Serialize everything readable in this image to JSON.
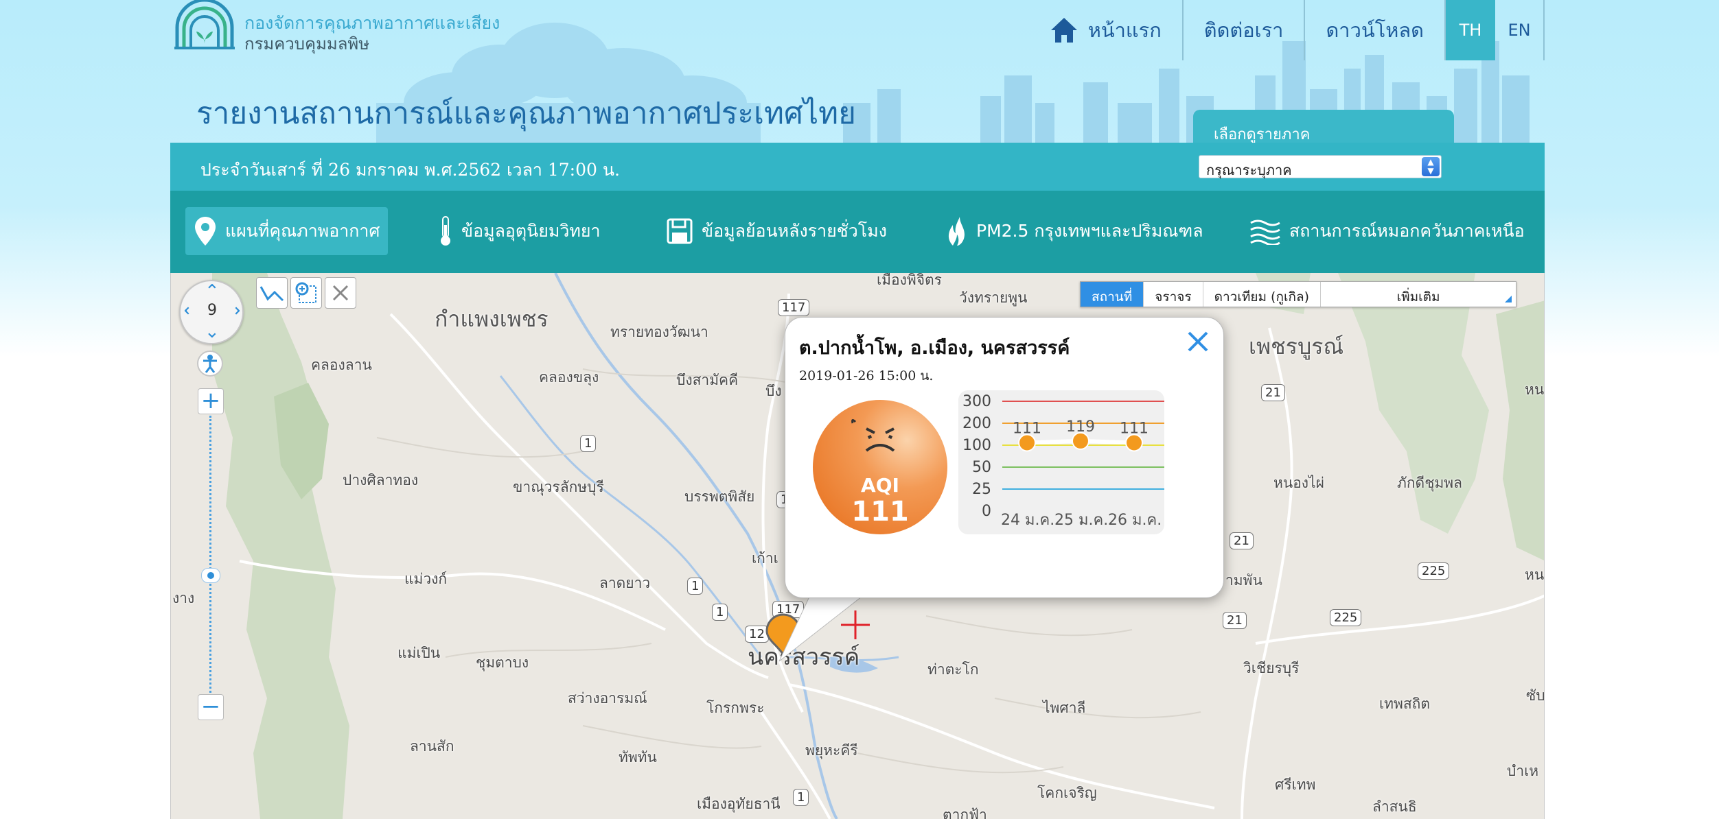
{
  "header": {
    "dept_line1": "กองจัดการคุณภาพอากาศและเสียง",
    "dept_line2": "กรมควบคุมมลพิษ",
    "site_title": "รายงานสถานการณ์และคุณภาพอากาศประเทศไทย",
    "nav": [
      {
        "label": "หน้าแรก",
        "icon": "home-icon"
      },
      {
        "label": "ติดต่อเรา"
      },
      {
        "label": "ดาวน์โหลด"
      }
    ],
    "languages": [
      "TH",
      "EN"
    ],
    "active_language": "TH"
  },
  "region": {
    "tab_label": "เลือกดูรายภาค",
    "select_value": "กรุณาระบุภาค"
  },
  "date_text": "ประจำวันเสาร์ ที่ 26 มกราคม พ.ศ.2562 เวลา 17:00 น.",
  "main_nav": [
    {
      "label": "แผนที่คุณภาพอากาศ",
      "icon": "map-pin-icon",
      "active": true
    },
    {
      "label": "ข้อมูลอุตุนิยมวิทยา",
      "icon": "thermometer-icon"
    },
    {
      "label": "ข้อมูลย้อนหลังรายชั่วโมง",
      "icon": "save-icon"
    },
    {
      "label": "PM2.5 กรุงเทพฯและปริมณฑล",
      "icon": "flame-icon"
    },
    {
      "label": "สถานการณ์หมอกควันภาคเหนือ",
      "icon": "haze-icon"
    }
  ],
  "map": {
    "zoom_level": "9",
    "map_types": [
      "สถานที่",
      "จราจร",
      "ดาวเทียม (กูเกิล)",
      "เพิ่มเติม"
    ],
    "active_map_type": "สถานที่",
    "places": [
      "กำแพงเพชร",
      "เพชรบูรณ์",
      "นครสวรรค์",
      "คลองลาน",
      "คลองขลุง",
      "บึงสามัคคี",
      "ทรายทองวัฒนา",
      "เมืองพิจิตร",
      "วังทรายพูน",
      "ปางศิลาทอง",
      "ขาณุวรลักษบุรี",
      "บรรพตพิสัย",
      "แม่วงก์",
      "ลาดยาว",
      "แม่เปิน",
      "ชุมตาบง",
      "สว่างอารมณ์",
      "โกรกพระ",
      "ท่าตะโก",
      "ไพศาลี",
      "ทัพทัน",
      "พยุหะคีรี",
      "ลานสัก",
      "เมืองอุทัยธานี",
      "โคกเจริญ",
      "ศรีเทพ",
      "ลำสนธิ",
      "วิเชียรบุรี",
      "เทพสถิต",
      "หนองไผ่",
      "ภักดีชุมพล",
      "หนองบัว",
      "บึง",
      "เก้าเ",
      "งาง",
      "ามพัน",
      "หนองบั",
      "ซับใ",
      "บำเห",
      "ตากฟ้า"
    ],
    "road_shields": [
      "117",
      "117",
      "1",
      "1",
      "1",
      "1",
      "1",
      "12",
      "21",
      "21",
      "21",
      "225",
      "225"
    ]
  },
  "popup": {
    "title": "ต.ปากน้ำโพ, อ.เมือง, นครสวรรค์",
    "timestamp": "2019-01-26 15:00 น.",
    "aqi_label": "AQI",
    "aqi_value": "111",
    "aqi_color": "#f0883a"
  },
  "chart_data": {
    "type": "line",
    "categories": [
      "24 ม.ค.",
      "25 ม.ค.",
      "26 ม.ค."
    ],
    "values": [
      111,
      119,
      111
    ],
    "y_ticks": [
      0,
      25,
      50,
      100,
      200,
      300
    ],
    "threshold_lines": [
      {
        "value": 300,
        "color": "#e05050"
      },
      {
        "value": 200,
        "color": "#f0a030"
      },
      {
        "value": 100,
        "color": "#e8e040"
      },
      {
        "value": 50,
        "color": "#7cc060"
      },
      {
        "value": 25,
        "color": "#40b0e0"
      }
    ],
    "point_color": "#f39a1e",
    "data_labels": true
  }
}
